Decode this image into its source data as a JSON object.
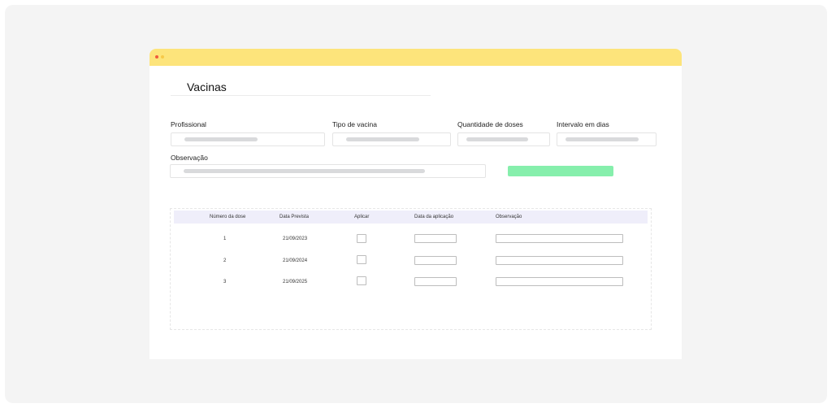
{
  "page": {
    "title": "Vacinas"
  },
  "form": {
    "profissional_label": "Profissional",
    "tipo_vacina_label": "Tipo de vacina",
    "quantidade_doses_label": "Quantidade de doses",
    "intervalo_dias_label": "Intervalo em dias",
    "observacao_label": "Observação"
  },
  "table": {
    "headers": [
      "Número da dose",
      "Data Prevista",
      "Aplicar",
      "Data da aplicação",
      "Observação"
    ],
    "rows": [
      {
        "dose": "1",
        "data_prevista": "21/09/2023"
      },
      {
        "dose": "2",
        "data_prevista": "21/09/2024"
      },
      {
        "dose": "3",
        "data_prevista": "21/09/2025"
      }
    ]
  },
  "colors": {
    "titlebar": "#fde47b",
    "action_button": "#86efac",
    "table_header": "#efeefa",
    "skeleton": "#d9dadc"
  }
}
